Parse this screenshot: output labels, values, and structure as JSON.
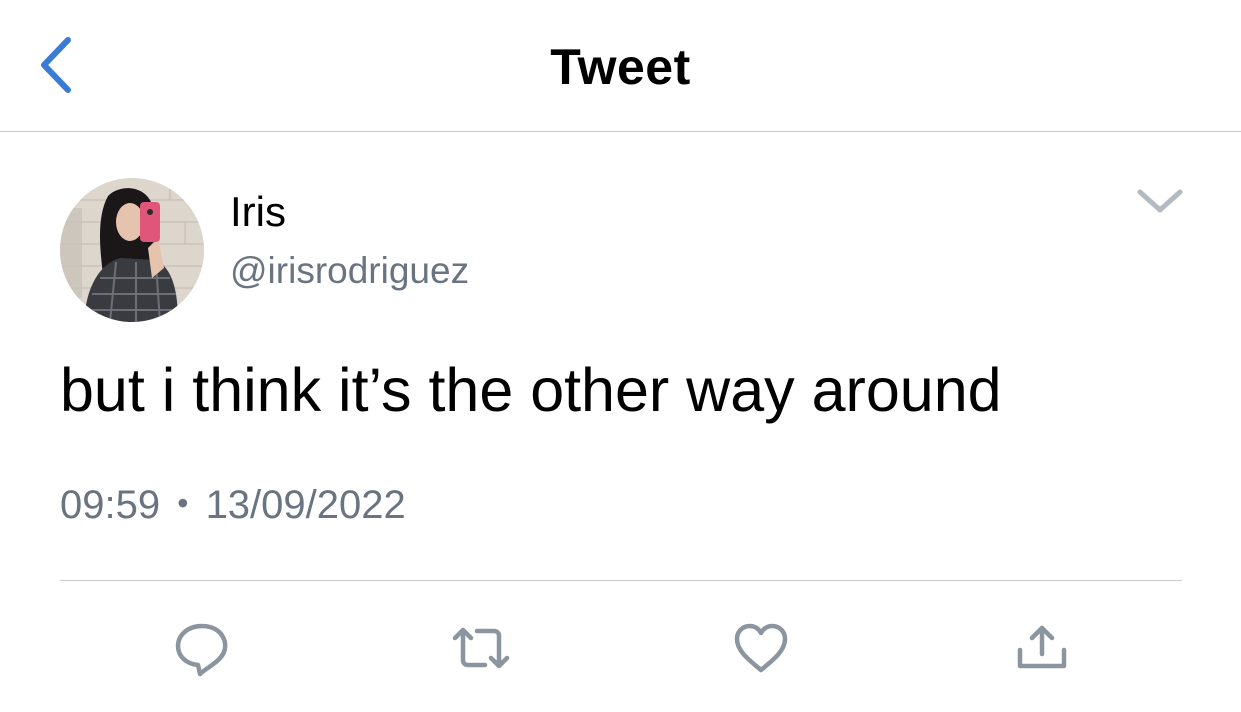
{
  "header": {
    "title": "Tweet",
    "back_icon": "chevron-left-icon",
    "accent_color": "#3a7bd5"
  },
  "author": {
    "name": "Iris",
    "handle": "@irisrodriguez",
    "avatar": "profile-photo"
  },
  "tweet": {
    "text": "but i think it’s the other way around",
    "time": "09:59",
    "separator": "•",
    "date": "13/09/2022"
  },
  "actions": [
    {
      "icon": "reply-icon"
    },
    {
      "icon": "retweet-icon"
    },
    {
      "icon": "like-icon"
    },
    {
      "icon": "share-icon"
    }
  ],
  "colors": {
    "text": "#000000",
    "secondary": "#697480",
    "icon_gray": "#8a959f",
    "divider": "#c9cdd1"
  }
}
